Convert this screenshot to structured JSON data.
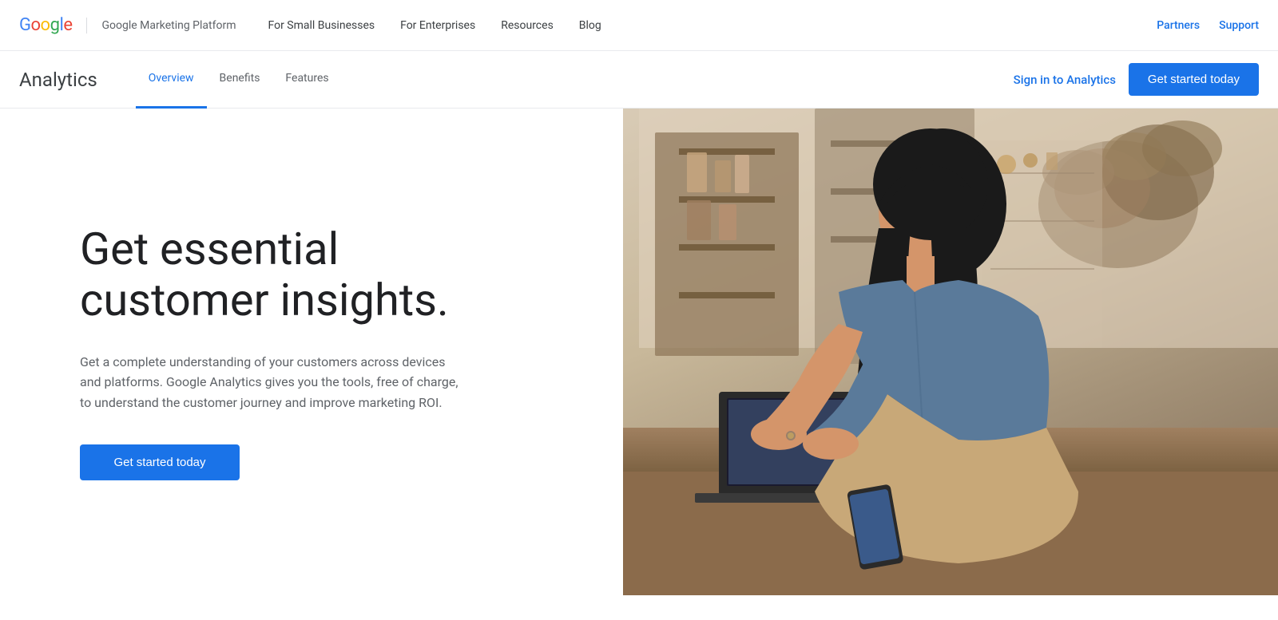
{
  "site": {
    "google_text_blue": "G",
    "google_text_red": "o",
    "google_text_yellow": "o",
    "google_text_green": "g",
    "google_text_blue2": "l",
    "google_text_red2": "e",
    "brand": "Google Marketing Platform"
  },
  "top_nav": {
    "brand_label": "Google Marketing Platform",
    "links": [
      {
        "label": "For Small Businesses"
      },
      {
        "label": "For Enterprises"
      },
      {
        "label": "Resources"
      },
      {
        "label": "Blog"
      }
    ],
    "right_links": [
      {
        "label": "Partners"
      },
      {
        "label": "Support"
      }
    ]
  },
  "secondary_nav": {
    "title": "Analytics",
    "tabs": [
      {
        "label": "Overview",
        "active": true
      },
      {
        "label": "Benefits",
        "active": false
      },
      {
        "label": "Features",
        "active": false
      }
    ],
    "sign_in_label": "Sign in to Analytics",
    "get_started_label": "Get started today"
  },
  "hero": {
    "title": "Get essential customer insights.",
    "description": "Get a complete understanding of your customers across devices and platforms. Google Analytics gives you the tools, free of charge, to understand the customer journey and improve marketing ROI.",
    "cta_label": "Get started today"
  }
}
